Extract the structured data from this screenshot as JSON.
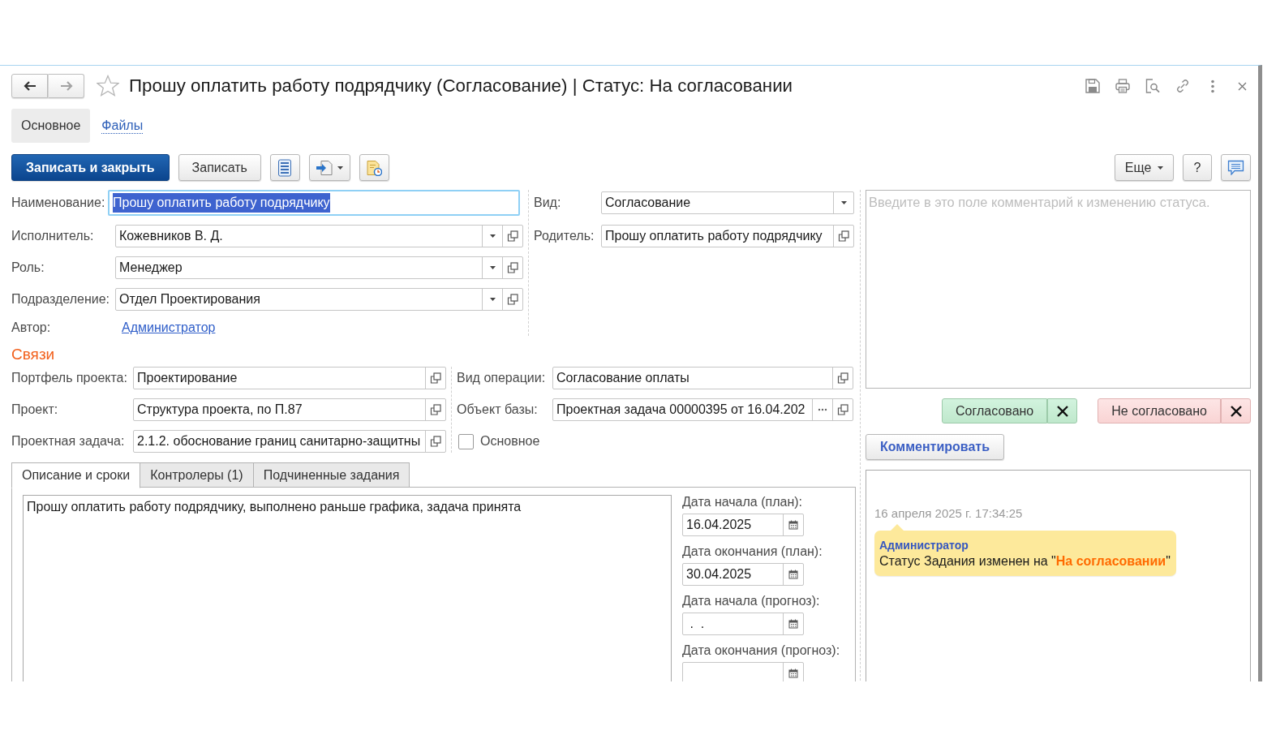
{
  "navigation": [
    {
      "kind": "back",
      "disabled": false
    },
    {
      "kind": "forward",
      "disabled": true
    }
  ],
  "window": {
    "favorite": false,
    "title": "Прошу оплатить работу подрядчику (Согласование) | Статус: На согласовании"
  },
  "form_tabs": [
    {
      "label": "Основное",
      "selected": true
    },
    {
      "label": "Файлы",
      "selected": false
    }
  ],
  "toolbar": {
    "buttons": [
      {
        "label": "Записать и закрыть",
        "kind": "primary"
      },
      {
        "label": "Записать",
        "kind": "plain"
      }
    ],
    "more_label": "Еще",
    "help_label": "?"
  },
  "main": {
    "left_fields": [
      {
        "label": "Наименование:",
        "value": "Прошу оплатить работу подрядчику",
        "kind": "text",
        "text_selected": true
      },
      {
        "label": "Исполнитель:",
        "value": "Кожевников В. Д.",
        "kind": "choice"
      },
      {
        "label": "Роль:",
        "value": "Менеджер",
        "kind": "choice"
      },
      {
        "label": "Подразделение:",
        "value": "Отдел Проектирования",
        "kind": "choice"
      },
      {
        "label": "Автор:",
        "value": "Администратор",
        "kind": "link"
      }
    ],
    "right_fields": [
      {
        "label": "Вид:",
        "value": "Согласование",
        "kind": "select"
      },
      {
        "label": "Родитель:",
        "value": "Прошу оплатить работу подрядчику",
        "kind": "ref"
      }
    ]
  },
  "links": {
    "title": "Связи",
    "left_fields": [
      {
        "label": "Портфель проекта:",
        "value": "Проектирование",
        "kind": "ref"
      },
      {
        "label": "Проект:",
        "value": "Структура проекта, по П.87",
        "kind": "ref"
      },
      {
        "label": "Проектная задача:",
        "value": "2.1.2. обоснование границ санитарно-защитны",
        "kind": "ref"
      }
    ],
    "right_fields": [
      {
        "label": "Вид операции:",
        "value": "Согласование оплаты",
        "kind": "ref"
      },
      {
        "label": "Объект базы:",
        "value": "Проектная задача 00000395 от 16.04.202",
        "kind": "ref_more"
      }
    ],
    "checkbox": {
      "label": "Основное",
      "checked": false
    }
  },
  "detail_tabs": [
    {
      "label": "Описание и сроки",
      "selected": true
    },
    {
      "label": "Контролеры (1)",
      "selected": false
    },
    {
      "label": "Подчиненные задания",
      "selected": false
    }
  ],
  "description": {
    "value": "Прошу оплатить работу подрядчику, выполнено раньше графика, задача принята"
  },
  "dates": [
    {
      "label": "Дата начала (план):",
      "value": "16.04.2025",
      "kind": "date"
    },
    {
      "label": "Дата окончания (план):",
      "value": "30.04.2025",
      "kind": "date"
    },
    {
      "label": "Дата начала (прогноз):",
      "value": " .  .",
      "kind": "date"
    },
    {
      "label": "Дата окончания (прогноз):",
      "kind": "date"
    }
  ],
  "status_panel": {
    "comment": {
      "placeholder": "Введите в это поле комментарий к изменению статуса."
    },
    "decisions": [
      {
        "label": "Согласовано",
        "kind": "approve"
      },
      {
        "label": "Не согласовано",
        "kind": "reject"
      }
    ],
    "comment_button": "Комментировать",
    "history": [
      {
        "time": "16 апреля 2025 г. 17:34:25",
        "author": "Администратор",
        "message": "Статус Задания изменен на \"**На согласовании**\""
      }
    ]
  }
}
